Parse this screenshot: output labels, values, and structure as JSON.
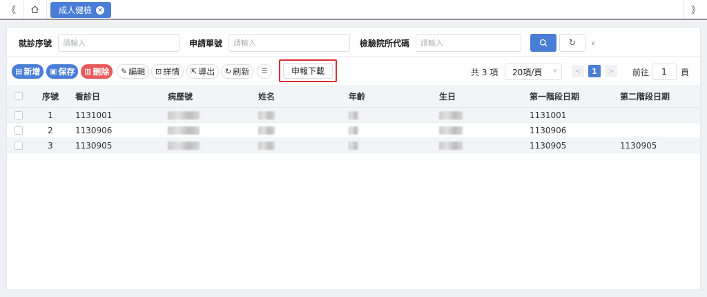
{
  "topbar": {
    "nav_left": "《",
    "nav_right": "》",
    "tab_label": "成人健檢",
    "tab_close": "×"
  },
  "search": {
    "field1_label": "就診序號",
    "field1_placeholder": "請輸入",
    "field2_label": "申請單號",
    "field2_placeholder": "請輸入",
    "field3_label": "檢驗院所代碼",
    "field3_placeholder": "請輸入",
    "reset_icon": "↻",
    "more_icon": "∨"
  },
  "toolbar": {
    "add": "新增",
    "save": "保存",
    "delete": "刪除",
    "edit": "編輯",
    "detail": "詳情",
    "export": "導出",
    "refresh": "刷新",
    "columns_icon": "☰",
    "report_download": "申報下載"
  },
  "pager": {
    "total": "共 3 項",
    "page_size": "20項/頁",
    "current_page": "1",
    "goto_label": "前往",
    "goto_value": "1",
    "goto_suffix": "頁"
  },
  "table": {
    "headers": {
      "seq": "序號",
      "visit_date": "看診日",
      "chart_no": "病歷號",
      "name": "姓名",
      "age": "年齡",
      "birthday": "生日",
      "phase1_date": "第一階段日期",
      "phase2_date": "第二階段日期"
    },
    "rows": [
      {
        "seq": "1",
        "visit_date": "1131001",
        "phase1_date": "1131001",
        "phase2_date": ""
      },
      {
        "seq": "2",
        "visit_date": "1130906",
        "phase1_date": "1130906",
        "phase2_date": ""
      },
      {
        "seq": "3",
        "visit_date": "1130905",
        "phase1_date": "1130905",
        "phase2_date": "1130905"
      }
    ]
  },
  "colors": {
    "primary": "#4a7ed6",
    "danger": "#e85a5a",
    "highlight_border": "#d62e2e"
  }
}
